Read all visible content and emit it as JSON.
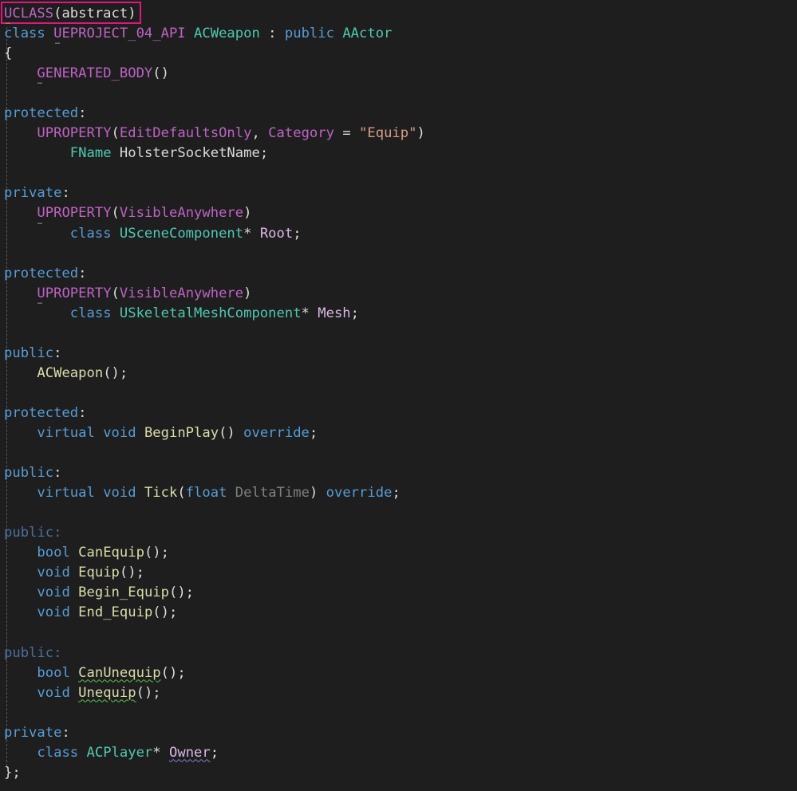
{
  "editor": {
    "lines": [
      [
        {
          "t": "UCLASS",
          "c": "macro"
        },
        {
          "t": "(abstract)",
          "c": "plain"
        }
      ],
      [
        {
          "t": "class ",
          "c": "kw"
        },
        {
          "t": "UEPROJECT_04_API",
          "c": "macro"
        },
        {
          "t": " ",
          "c": "plain"
        },
        {
          "t": "ACWeapon",
          "c": "type"
        },
        {
          "t": " : ",
          "c": "plain"
        },
        {
          "t": "public ",
          "c": "kw"
        },
        {
          "t": "AActor",
          "c": "type"
        }
      ],
      [
        {
          "t": "{",
          "c": "plain"
        }
      ],
      [
        {
          "t": "    ",
          "c": "plain"
        },
        {
          "t": "GENERATED_BODY",
          "c": "macro"
        },
        {
          "t": "()",
          "c": "plain"
        }
      ],
      [],
      [
        {
          "t": "protected",
          "c": "kw"
        },
        {
          "t": ":",
          "c": "plain"
        }
      ],
      [
        {
          "t": "    ",
          "c": "plain"
        },
        {
          "t": "UPROPERTY",
          "c": "macro"
        },
        {
          "t": "(",
          "c": "plain"
        },
        {
          "t": "EditDefaultsOnly",
          "c": "macro"
        },
        {
          "t": ", ",
          "c": "plain"
        },
        {
          "t": "Category",
          "c": "macro"
        },
        {
          "t": " = ",
          "c": "plain"
        },
        {
          "t": "\"Equip\"",
          "c": "str"
        },
        {
          "t": ")",
          "c": "plain"
        }
      ],
      [
        {
          "t": "        ",
          "c": "plain"
        },
        {
          "t": "FName",
          "c": "type"
        },
        {
          "t": " ",
          "c": "plain"
        },
        {
          "t": "HolsterSocketName",
          "c": "field"
        },
        {
          "t": ";",
          "c": "plain"
        }
      ],
      [],
      [
        {
          "t": "private",
          "c": "kw"
        },
        {
          "t": ":",
          "c": "plain"
        }
      ],
      [
        {
          "t": "    ",
          "c": "plain"
        },
        {
          "t": "UPROPERTY",
          "c": "macro"
        },
        {
          "t": "(",
          "c": "plain"
        },
        {
          "t": "VisibleAnywhere",
          "c": "macro"
        },
        {
          "t": ")",
          "c": "plain"
        }
      ],
      [
        {
          "t": "        ",
          "c": "plain"
        },
        {
          "t": "class ",
          "c": "kw"
        },
        {
          "t": "USceneComponent",
          "c": "type"
        },
        {
          "t": "* ",
          "c": "plain"
        },
        {
          "t": "Root",
          "c": "member"
        },
        {
          "t": ";",
          "c": "plain"
        }
      ],
      [],
      [
        {
          "t": "protected",
          "c": "kw"
        },
        {
          "t": ":",
          "c": "plain"
        }
      ],
      [
        {
          "t": "    ",
          "c": "plain"
        },
        {
          "t": "UPROPERTY",
          "c": "macro"
        },
        {
          "t": "(",
          "c": "plain"
        },
        {
          "t": "VisibleAnywhere",
          "c": "macro"
        },
        {
          "t": ")",
          "c": "plain"
        }
      ],
      [
        {
          "t": "        ",
          "c": "plain"
        },
        {
          "t": "class ",
          "c": "kw"
        },
        {
          "t": "USkeletalMeshComponent",
          "c": "type"
        },
        {
          "t": "* ",
          "c": "plain"
        },
        {
          "t": "Mesh",
          "c": "member"
        },
        {
          "t": ";",
          "c": "plain"
        }
      ],
      [],
      [
        {
          "t": "public",
          "c": "kw"
        },
        {
          "t": ":",
          "c": "plain"
        }
      ],
      [
        {
          "t": "    ",
          "c": "plain"
        },
        {
          "t": "ACWeapon",
          "c": "fn"
        },
        {
          "t": "();",
          "c": "plain"
        }
      ],
      [],
      [
        {
          "t": "protected",
          "c": "kw"
        },
        {
          "t": ":",
          "c": "plain"
        }
      ],
      [
        {
          "t": "    ",
          "c": "plain"
        },
        {
          "t": "virtual void ",
          "c": "kw"
        },
        {
          "t": "BeginPlay",
          "c": "fn"
        },
        {
          "t": "() ",
          "c": "plain"
        },
        {
          "t": "override",
          "c": "kw"
        },
        {
          "t": ";",
          "c": "plain"
        }
      ],
      [],
      [
        {
          "t": "public",
          "c": "kw"
        },
        {
          "t": ":",
          "c": "plain"
        }
      ],
      [
        {
          "t": "    ",
          "c": "plain"
        },
        {
          "t": "virtual void ",
          "c": "kw"
        },
        {
          "t": "Tick",
          "c": "fn"
        },
        {
          "t": "(",
          "c": "plain"
        },
        {
          "t": "float ",
          "c": "kw"
        },
        {
          "t": "DeltaTime",
          "c": "param"
        },
        {
          "t": ") ",
          "c": "plain"
        },
        {
          "t": "override",
          "c": "kw"
        },
        {
          "t": ";",
          "c": "plain"
        }
      ],
      [],
      [
        {
          "t": "public",
          "c": "dim"
        },
        {
          "t": ":",
          "c": "dim"
        }
      ],
      [
        {
          "t": "    ",
          "c": "plain"
        },
        {
          "t": "bool ",
          "c": "kw"
        },
        {
          "t": "CanEquip",
          "c": "fn"
        },
        {
          "t": "();",
          "c": "plain"
        }
      ],
      [
        {
          "t": "    ",
          "c": "plain"
        },
        {
          "t": "void ",
          "c": "kw"
        },
        {
          "t": "Equip",
          "c": "fn"
        },
        {
          "t": "();",
          "c": "plain"
        }
      ],
      [
        {
          "t": "    ",
          "c": "plain"
        },
        {
          "t": "void ",
          "c": "kw"
        },
        {
          "t": "Begin_Equip",
          "c": "fn"
        },
        {
          "t": "();",
          "c": "plain"
        }
      ],
      [
        {
          "t": "    ",
          "c": "plain"
        },
        {
          "t": "void ",
          "c": "kw"
        },
        {
          "t": "End_Equip",
          "c": "fn"
        },
        {
          "t": "();",
          "c": "plain"
        }
      ],
      [],
      [
        {
          "t": "public",
          "c": "dim"
        },
        {
          "t": ":",
          "c": "dim"
        }
      ],
      [
        {
          "t": "    ",
          "c": "plain"
        },
        {
          "t": "bool ",
          "c": "kw"
        },
        {
          "t": "CanUnequip",
          "c": "fn",
          "sq": "green"
        },
        {
          "t": "();",
          "c": "plain"
        }
      ],
      [
        {
          "t": "    ",
          "c": "plain"
        },
        {
          "t": "void ",
          "c": "kw"
        },
        {
          "t": "Unequip",
          "c": "fn",
          "sq": "green"
        },
        {
          "t": "();",
          "c": "plain"
        }
      ],
      [],
      [
        {
          "t": "private",
          "c": "kw"
        },
        {
          "t": ":",
          "c": "plain"
        }
      ],
      [
        {
          "t": "    ",
          "c": "plain"
        },
        {
          "t": "class ",
          "c": "kw"
        },
        {
          "t": "ACPlayer",
          "c": "type"
        },
        {
          "t": "* ",
          "c": "plain"
        },
        {
          "t": "Owner",
          "c": "member",
          "sq": "purple"
        },
        {
          "t": ";",
          "c": "plain"
        }
      ],
      [
        {
          "t": "};",
          "c": "plain"
        }
      ]
    ]
  }
}
